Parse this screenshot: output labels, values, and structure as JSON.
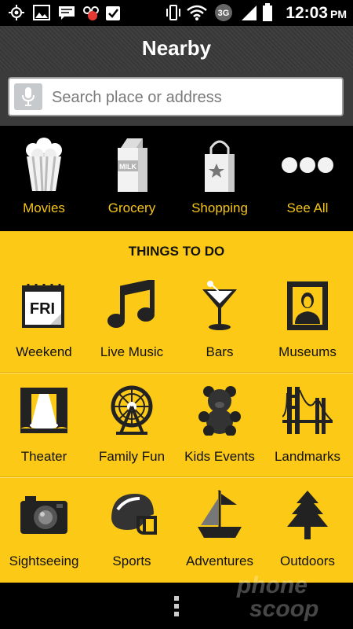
{
  "status_bar": {
    "time": "12:03",
    "ampm": "PM",
    "network": "3G",
    "notification_count": "1",
    "icons": [
      "location-icon",
      "gallery-icon",
      "message-icon",
      "voicemail-icon",
      "checkbox-icon",
      "vibrate-icon",
      "wifi-icon",
      "3g-icon",
      "signal-icon",
      "battery-icon"
    ]
  },
  "header": {
    "title": "Nearby"
  },
  "search": {
    "placeholder": "Search place or address",
    "mic_icon": "microphone-icon"
  },
  "categories": [
    {
      "label": "Movies",
      "icon": "popcorn-icon"
    },
    {
      "label": "Grocery",
      "icon": "milk-carton-icon"
    },
    {
      "label": "Shopping",
      "icon": "shopping-bag-icon"
    },
    {
      "label": "See All",
      "icon": "more-dots-icon"
    }
  ],
  "things_to_do": {
    "title": "THINGS TO DO",
    "rows": [
      [
        {
          "label": "Weekend",
          "icon": "calendar-fri-icon",
          "badge": "FRI"
        },
        {
          "label": "Live Music",
          "icon": "music-note-icon"
        },
        {
          "label": "Bars",
          "icon": "martini-icon"
        },
        {
          "label": "Museums",
          "icon": "mona-lisa-icon"
        }
      ],
      [
        {
          "label": "Theater",
          "icon": "stage-icon"
        },
        {
          "label": "Family Fun",
          "icon": "ferris-wheel-icon"
        },
        {
          "label": "Kids Events",
          "icon": "teddy-bear-icon"
        },
        {
          "label": "Landmarks",
          "icon": "bridge-icon"
        }
      ],
      [
        {
          "label": "Sightseeing",
          "icon": "camera-icon"
        },
        {
          "label": "Sports",
          "icon": "football-helmet-icon"
        },
        {
          "label": "Adventures",
          "icon": "sailboat-icon"
        },
        {
          "label": "Outdoors",
          "icon": "pine-tree-icon"
        }
      ]
    ]
  },
  "nav": {
    "menu_icon": "overflow-menu-icon"
  },
  "watermark": {
    "line1": "phone",
    "line2": "scoop"
  },
  "colors": {
    "accent_yellow": "#fcc916",
    "label_yellow": "#f5c518",
    "background": "#000000"
  }
}
